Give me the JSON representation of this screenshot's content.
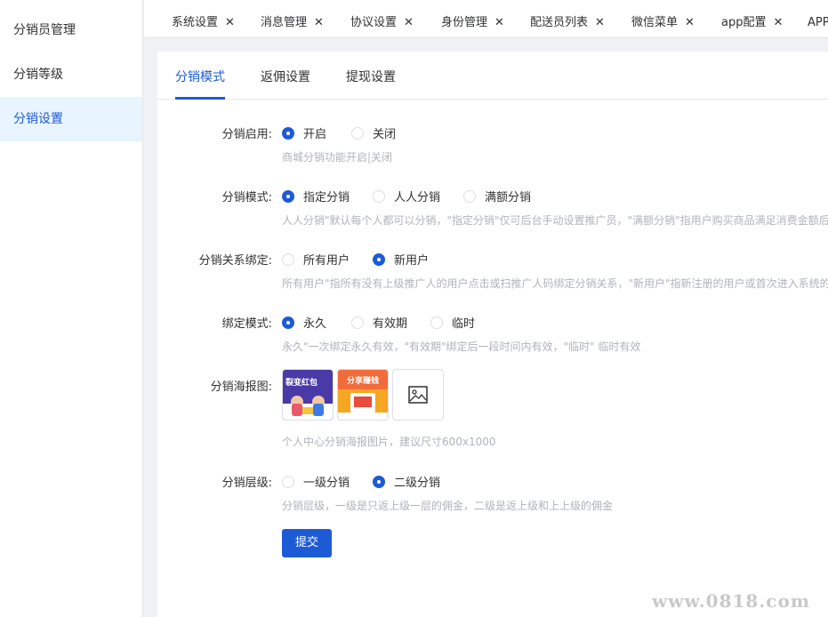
{
  "sidebar": {
    "items": [
      {
        "label": "分销员管理"
      },
      {
        "label": "分销等级"
      },
      {
        "label": "分销设置"
      }
    ]
  },
  "tagbar": {
    "tabs": [
      {
        "label": "系统设置"
      },
      {
        "label": "消息管理"
      },
      {
        "label": "协议设置"
      },
      {
        "label": "身份管理"
      },
      {
        "label": "配送员列表"
      },
      {
        "label": "微信菜单"
      },
      {
        "label": "app配置"
      },
      {
        "label": "APP"
      }
    ],
    "close_glyph": "✕"
  },
  "subtabs": [
    {
      "label": "分销模式"
    },
    {
      "label": "返佣设置"
    },
    {
      "label": "提现设置"
    }
  ],
  "form": {
    "enable": {
      "label": "分销启用:",
      "options": [
        "开启",
        "关闭"
      ],
      "selected": "开启",
      "hint": "商城分销功能开启|关闭"
    },
    "mode": {
      "label": "分销模式:",
      "options": [
        "指定分销",
        "人人分销",
        "满额分销"
      ],
      "selected": "指定分销",
      "hint": "人人分销\"默认每个人都可以分销，\"指定分销\"仅可后台手动设置推广员，\"满额分销\"指用户购买商品满足消费金额后自"
    },
    "binding": {
      "label": "分销关系绑定:",
      "options": [
        "所有用户",
        "新用户"
      ],
      "selected": "新用户",
      "hint": "所有用户\"指所有没有上级推广人的用户点击或扫推广人码绑定分销关系，\"新用户\"指新注册的用户或首次进入系统的"
    },
    "bind_mode": {
      "label": "绑定模式:",
      "options": [
        "永久",
        "有效期",
        "临时"
      ],
      "selected": "永久",
      "hint": "永久\"一次绑定永久有效，\"有效期\"绑定后一段时间内有效，\"临时\" 临时有效"
    },
    "poster": {
      "label": "分销海报图:",
      "poster1_text": "裂变红包",
      "poster2_text": "分享赚钱",
      "hint": "个人中心分销海报图片，建议尺寸600x1000",
      "upload_icon": "image-icon"
    },
    "level": {
      "label": "分销层级:",
      "options": [
        "一级分销",
        "二级分销"
      ],
      "selected": "二级分销",
      "hint": "分销层级，一级是只返上级一层的佣金，二级是返上级和上上级的佣金"
    },
    "submit_label": "提交"
  },
  "watermark": "www.0818.com",
  "colors": {
    "accent": "#1d5bd6",
    "sidebar_active_bg": "#e8f4ff",
    "hint_text": "#b0b3b8"
  }
}
